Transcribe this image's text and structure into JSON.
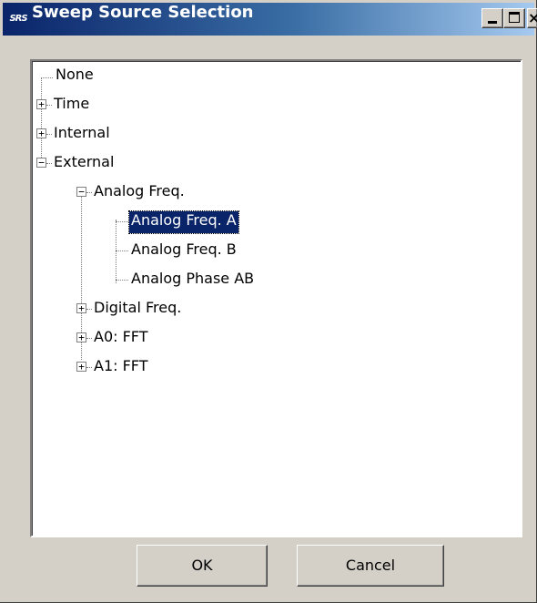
{
  "window": {
    "title": "Sweep Source Selection",
    "app_icon_text": "SRS"
  },
  "tree": {
    "nodes": [
      {
        "label": "None",
        "expander": "",
        "selected": false
      },
      {
        "label": "Time",
        "expander": "+",
        "selected": false
      },
      {
        "label": "Internal",
        "expander": "+",
        "selected": false
      },
      {
        "label": "External",
        "expander": "−",
        "selected": false
      },
      {
        "label": "Analog Freq.",
        "expander": "−",
        "selected": false
      },
      {
        "label": "Analog Freq. A",
        "expander": "",
        "selected": true
      },
      {
        "label": "Analog Freq. B",
        "expander": "",
        "selected": false
      },
      {
        "label": "Analog Phase AB",
        "expander": "",
        "selected": false
      },
      {
        "label": "Digital Freq.",
        "expander": "+",
        "selected": false
      },
      {
        "label": "A0: FFT",
        "expander": "+",
        "selected": false
      },
      {
        "label": "A1: FFT",
        "expander": "+",
        "selected": false
      }
    ]
  },
  "buttons": {
    "ok_label": "OK",
    "cancel_label": "Cancel"
  },
  "colors": {
    "title_bar_start": "#0a246a",
    "title_bar_end": "#a6caf0",
    "selection": "#0a246a",
    "dialog_face": "#d4d0c8"
  }
}
